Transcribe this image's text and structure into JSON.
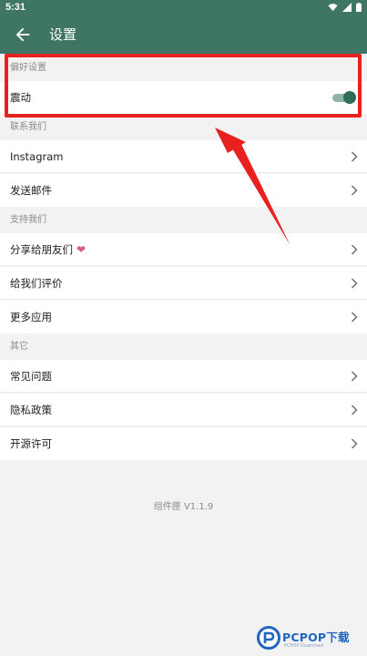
{
  "status_bar": {
    "time": "5:31"
  },
  "app_bar": {
    "title": "设置"
  },
  "sections": {
    "preferences": {
      "header": "偏好设置",
      "vibrate_label": "震动",
      "vibrate_on": true
    },
    "contact": {
      "header": "联系我们",
      "items": [
        "Instagram",
        "发送邮件"
      ]
    },
    "support": {
      "header": "支持我们",
      "items": [
        "分享给朋友们",
        "给我们评价",
        "更多应用"
      ]
    },
    "other": {
      "header": "其它",
      "items": [
        "常见问题",
        "隐私政策",
        "开源许可"
      ]
    }
  },
  "version_text": "组件匣 V1.1.9",
  "watermark": {
    "brand": "PCPOP下载",
    "sub": "PCPOP Download"
  },
  "colors": {
    "primary": "#3e7565",
    "annotation": "#e8201e",
    "heart": "#d65a90"
  }
}
